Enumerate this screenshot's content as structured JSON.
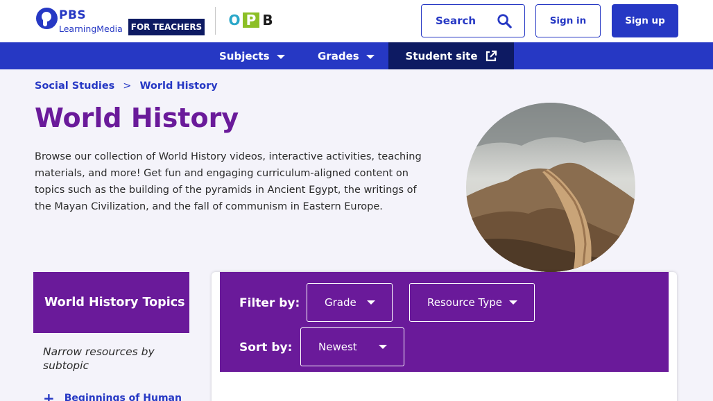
{
  "header": {
    "logo_brand": "PBS",
    "logo_sub": "LearningMedia",
    "audience_badge": "FOR TEACHERS",
    "station_letters": [
      "O",
      "P",
      "B"
    ],
    "search_label": "Search",
    "signin_label": "Sign in",
    "signup_label": "Sign up"
  },
  "nav": {
    "subjects": "Subjects",
    "grades": "Grades",
    "student_site": "Student site"
  },
  "breadcrumb": {
    "items": [
      "Social Studies",
      "World History"
    ],
    "separator": ">"
  },
  "page": {
    "title": "World History",
    "intro": "Browse our collection of World History videos, interactive activities, teaching materials, and more! Get fun and engaging curriculum-aligned content on topics such as the building of the pyramids in Ancient Egypt, the writings of the Mayan Civilization, and the fall of communism in Eastern Europe."
  },
  "sidebar": {
    "heading": "World History Topics",
    "note": "Narrow resources by subtopic",
    "items": [
      {
        "label": "Beginnings of Human"
      }
    ]
  },
  "filters": {
    "filter_label": "Filter by:",
    "grade_label": "Grade",
    "resource_type_label": "Resource Type",
    "sort_label": "Sort by:",
    "sort_value": "Newest"
  },
  "icons": {
    "search": "search-icon",
    "external": "external-link-icon",
    "caret": "caret-down-icon",
    "plus": "plus-icon"
  },
  "colors": {
    "brand_blue": "#2638c4",
    "navy": "#0d1a62",
    "purple": "#6a1a9a",
    "page_bg": "#f4f3fa"
  }
}
